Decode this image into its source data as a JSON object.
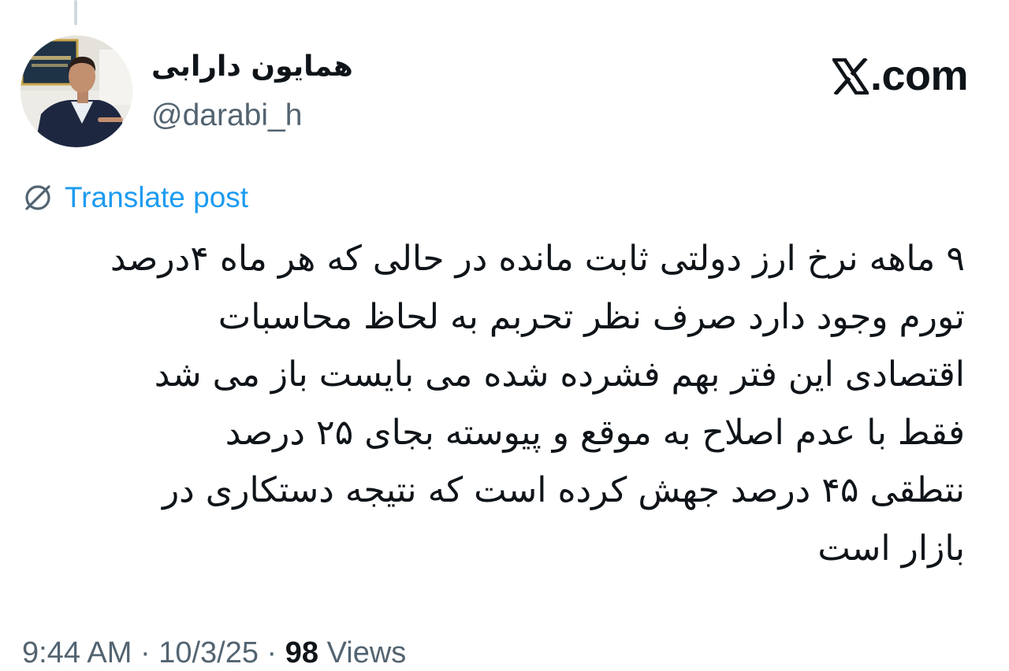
{
  "author": {
    "display_name": "همایون دارابی",
    "handle": "@darabi_h"
  },
  "brand": {
    "name": ".com",
    "logo_icon": "x-logo-icon"
  },
  "translate": {
    "label": "Translate post",
    "icon": "translate-globe-icon",
    "color": "#1d9bf0"
  },
  "tweet": {
    "lines": [
      "۹ ماهه نرخ ارز دولتی ثابت مانده در حالی که هر ماه ۴درصد",
      "تورم وجود دارد صرف نظر تحربم به لحاظ محاسبات",
      "اقتصادی این فتر بهم فشرده شده می بایست باز می شد",
      "فقط با عدم اصلاح به موقع و پیوسته بجای ۲۵ درصد",
      "نتطقی ۴۵ درصد جهش کرده است که نتیجه دستکاری در",
      "بازار است"
    ]
  },
  "meta": {
    "time": "9:44 AM",
    "separator": " · ",
    "date": "10/3/25",
    "views_count": "98",
    "views_label": " Views"
  },
  "colors": {
    "text_primary": "#0f1419",
    "text_secondary": "#536471",
    "thread_line": "#cfd9de"
  }
}
